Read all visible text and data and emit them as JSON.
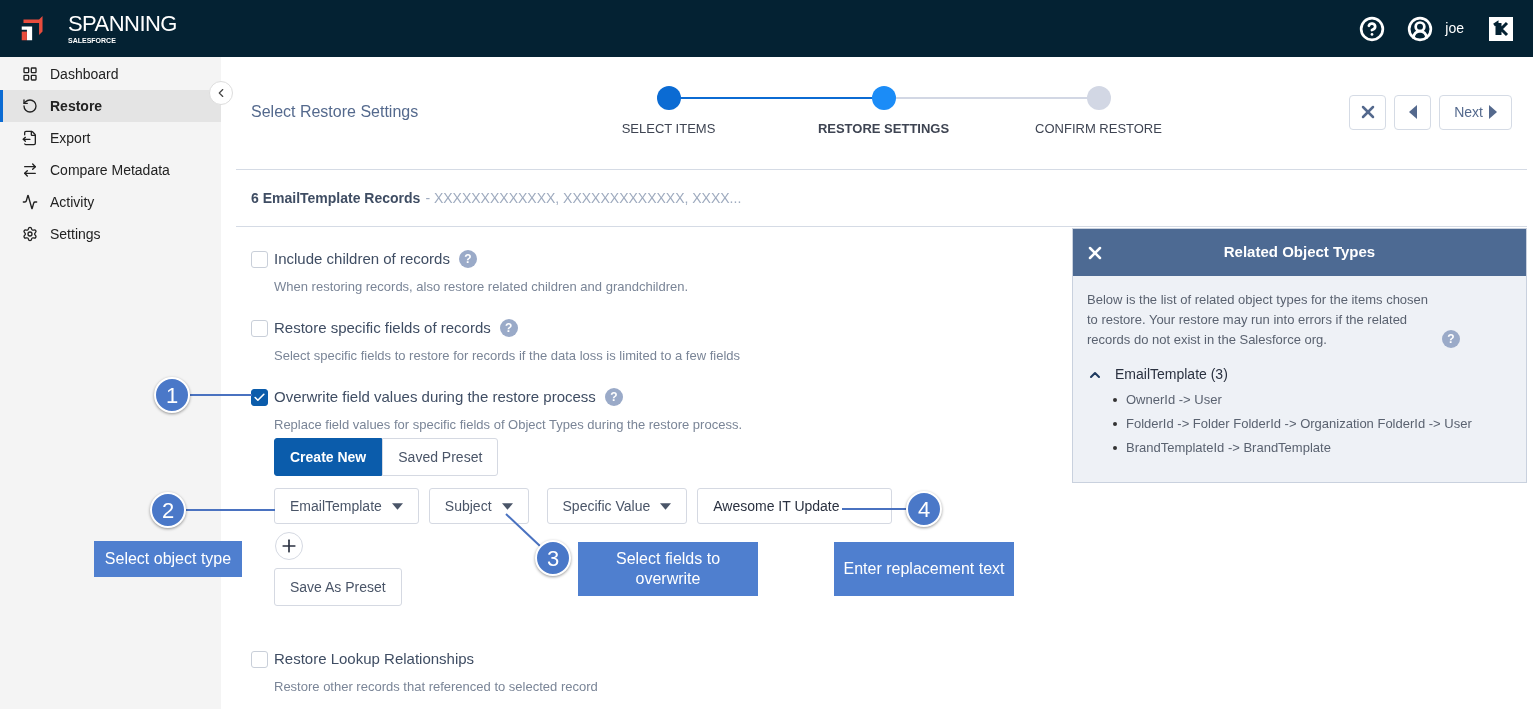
{
  "header": {
    "brand": "SPANNING",
    "brand_sub": "SALESFORCE",
    "user": "joe"
  },
  "sidebar": {
    "items": [
      {
        "label": "Dashboard",
        "selected": false
      },
      {
        "label": "Restore",
        "selected": true
      },
      {
        "label": "Export",
        "selected": false
      },
      {
        "label": "Compare Metadata",
        "selected": false
      },
      {
        "label": "Activity",
        "selected": false
      },
      {
        "label": "Settings",
        "selected": false
      }
    ]
  },
  "page_title": "Select Restore Settings",
  "steps": [
    {
      "label": "SELECT ITEMS",
      "completed": true,
      "selected": false
    },
    {
      "label": "RESTORE SETTINGS",
      "completed": false,
      "selected": true
    },
    {
      "label": "CONFIRM RESTORE",
      "completed": false,
      "selected": false
    }
  ],
  "nav": {
    "next": "Next"
  },
  "records": {
    "title": "6 EmailTemplate Records",
    "list": "- XXXXXXXXXXXXX, XXXXXXXXXXXXX, XXXX..."
  },
  "options": [
    {
      "label": "Include children of records",
      "help": "?",
      "description": "When restoring records, also restore related children and grandchildren.",
      "checked": false
    },
    {
      "label": "Restore specific fields of records",
      "help": "?",
      "description": "Select specific fields to restore for records if the data loss is limited to a few fields",
      "checked": false
    },
    {
      "label": "Overwrite field values during the restore process",
      "help": "?",
      "description": "Replace field values for specific fields of Object Types during the restore process.",
      "checked": true,
      "rule_builder": {
        "modes": [
          {
            "label": "Create New",
            "selected": true
          },
          {
            "label": "Saved Preset",
            "selected": false
          }
        ],
        "dropdowns": [
          "EmailTemplate",
          "Subject",
          "Specific Value"
        ],
        "value": "Awesome IT Update",
        "save": "Save As Preset"
      }
    },
    {
      "label": "Restore Lookup Relationships",
      "description": "Restore other records that referenced to selected record",
      "checked": false
    }
  ],
  "related_panel": {
    "title": "Related Object Types",
    "intro": "Below is the list of related object types for the items chosen to restore. Your restore may run into errors if the related records do not exist in the Salesforce org.",
    "help": "?",
    "groups": [
      {
        "label": "EmailTemplate (3)",
        "expanded": true,
        "children": [
          {
            "label": "OwnerId -> User"
          },
          {
            "label": "FolderId -> Folder FolderId -> Organization FolderId -> User"
          },
          {
            "label": "BrandTemplateId -> BrandTemplate"
          }
        ]
      }
    ]
  },
  "callouts": [
    {
      "number": "1"
    },
    {
      "number": "2",
      "note": "Select object type"
    },
    {
      "number": "3",
      "note": "Select fields to overwrite"
    },
    {
      "number": "4",
      "note": "Enter replacement text"
    }
  ]
}
